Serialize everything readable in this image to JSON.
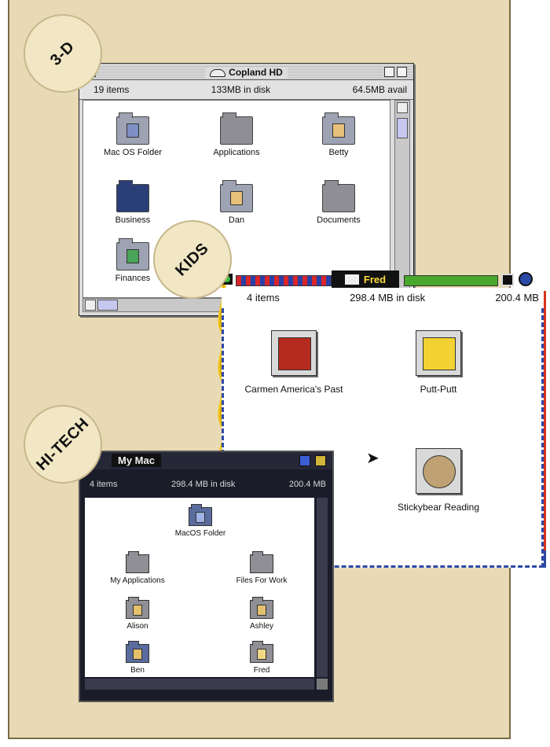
{
  "badges": {
    "badge3d": "3-D",
    "badgeKids": "KIDS",
    "badgeHiTech": "HI-TECH"
  },
  "window3d": {
    "title": "Copland HD",
    "items": "19 items",
    "disk": "133MB in disk",
    "avail": "64.5MB avail",
    "icons": [
      {
        "label": "Mac OS Folder"
      },
      {
        "label": "Applications"
      },
      {
        "label": "Betty"
      },
      {
        "label": "Business"
      },
      {
        "label": "Dan"
      },
      {
        "label": "Documents"
      },
      {
        "label": "Finances"
      }
    ]
  },
  "kidsWindow": {
    "title": "Fred",
    "items": "4 items",
    "disk": "298.4 MB in disk",
    "avail": "200.4 MB",
    "icons": [
      {
        "label": "Carmen America's Past"
      },
      {
        "label": "Putt-Putt"
      },
      {
        "label": "Stickybear Reading"
      }
    ]
  },
  "hitechWindow": {
    "title": "My Mac",
    "items": "4 items",
    "disk": "298.4 MB in disk",
    "avail": "200.4 MB",
    "icons": [
      {
        "label": "MacOS Folder"
      },
      {
        "label": "My Applications"
      },
      {
        "label": "Files For Work"
      },
      {
        "label": "Alison"
      },
      {
        "label": "Ashley"
      },
      {
        "label": "Ben"
      },
      {
        "label": "Fred"
      }
    ]
  }
}
